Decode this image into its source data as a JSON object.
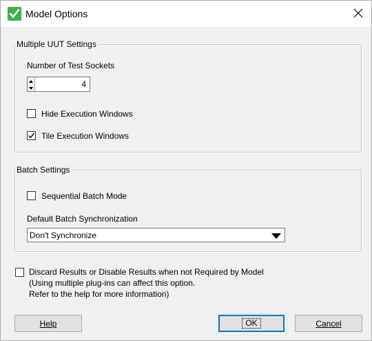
{
  "window": {
    "title": "Model Options"
  },
  "icons": {
    "app": "green-checkmark-icon",
    "close": "close-icon",
    "spin": "spin-arrows-icon",
    "dropdown": "dropdown-arrow-icon",
    "check": "checkmark-icon"
  },
  "colors": {
    "app_icon": "#3fb24a",
    "default_button_border": "#0078d7",
    "dialog_bg": "#f0f0f0"
  },
  "uut_group": {
    "legend": "Multiple UUT Settings",
    "sockets_label": "Number of Test Sockets",
    "sockets_value": "4",
    "hide_windows_label": "Hide Execution Windows",
    "hide_windows_checked": false,
    "tile_windows_label": "Tile Execution Windows",
    "tile_windows_checked": true
  },
  "batch_group": {
    "legend": "Batch Settings",
    "sequential_label": "Sequential Batch Mode",
    "sequential_checked": false,
    "sync_label": "Default Batch Synchronization",
    "sync_value": "Don't Synchronize"
  },
  "discard": {
    "label_line1": "Discard Results or Disable Results when not Required by Model",
    "label_line2": "(Using multiple plug-ins can affect this option.",
    "label_line3": "Refer to the help for more information)",
    "checked": false
  },
  "buttons": {
    "help": "Help",
    "ok": "OK",
    "cancel": "Cancel"
  }
}
